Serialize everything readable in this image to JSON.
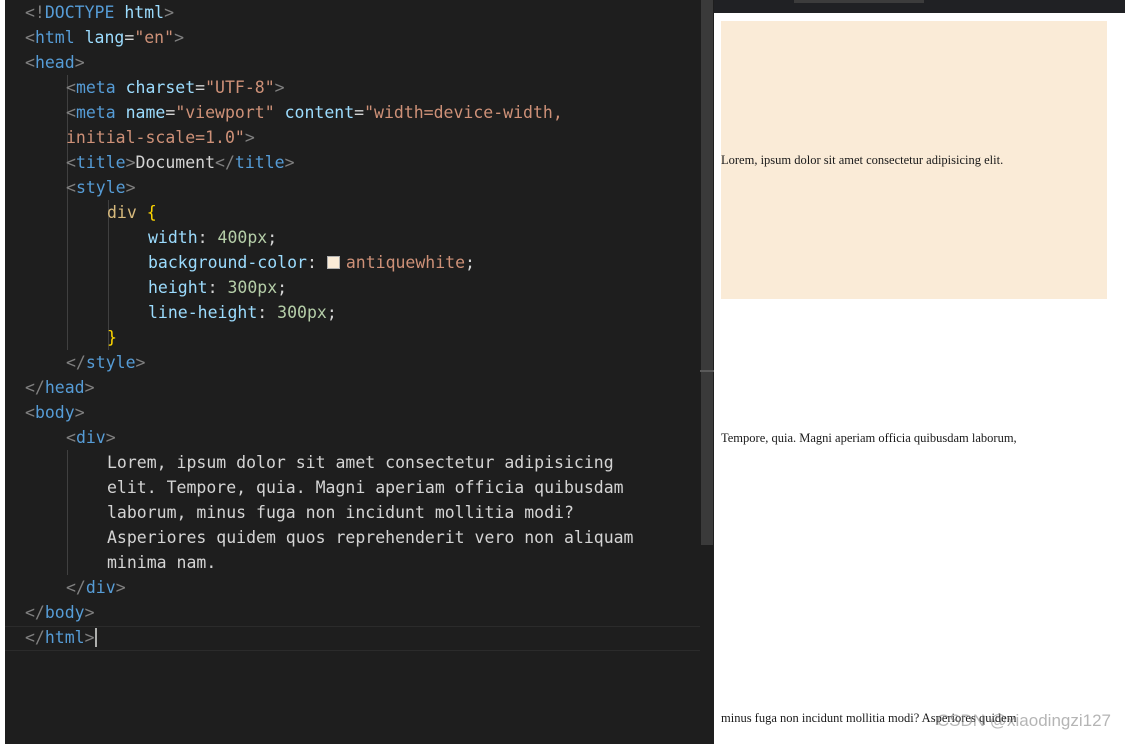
{
  "editor": {
    "lines": [
      [
        [
          "t-punc",
          "<!"
        ],
        [
          "t-kw",
          "DOCTYPE"
        ],
        [
          "t-text",
          " "
        ],
        [
          "t-attr",
          "html"
        ],
        [
          "t-punc",
          ">"
        ]
      ],
      [
        [
          "t-punc",
          "<"
        ],
        [
          "t-tag",
          "html"
        ],
        [
          "t-text",
          " "
        ],
        [
          "t-attr",
          "lang"
        ],
        [
          "t-text",
          "="
        ],
        [
          "t-str",
          "\"en\""
        ],
        [
          "t-punc",
          ">"
        ]
      ],
      [
        [
          "t-punc",
          "<"
        ],
        [
          "t-tag",
          "head"
        ],
        [
          "t-punc",
          ">"
        ]
      ],
      [
        [
          "t-punc",
          "<"
        ],
        [
          "t-tag",
          "meta"
        ],
        [
          "t-text",
          " "
        ],
        [
          "t-attr",
          "charset"
        ],
        [
          "t-text",
          "="
        ],
        [
          "t-str",
          "\"UTF-8\""
        ],
        [
          "t-punc",
          ">"
        ]
      ],
      [
        [
          "t-punc",
          "<"
        ],
        [
          "t-tag",
          "meta"
        ],
        [
          "t-text",
          " "
        ],
        [
          "t-attr",
          "name"
        ],
        [
          "t-text",
          "="
        ],
        [
          "t-str",
          "\"viewport\""
        ],
        [
          "t-text",
          " "
        ],
        [
          "t-attr",
          "content"
        ],
        [
          "t-text",
          "="
        ],
        [
          "t-str",
          "\"width=device-width,"
        ]
      ],
      [
        [
          "t-str",
          "initial-scale=1.0\""
        ],
        [
          "t-punc",
          ">"
        ]
      ],
      [
        [
          "t-punc",
          "<"
        ],
        [
          "t-tag",
          "title"
        ],
        [
          "t-punc",
          ">"
        ],
        [
          "t-text",
          "Document"
        ],
        [
          "t-punc",
          "</"
        ],
        [
          "t-tag",
          "title"
        ],
        [
          "t-punc",
          ">"
        ]
      ],
      [
        [
          "t-punc",
          "<"
        ],
        [
          "t-tag",
          "style"
        ],
        [
          "t-punc",
          ">"
        ]
      ],
      [
        [
          "t-sel",
          "div"
        ],
        [
          "t-text",
          " "
        ],
        [
          "t-brace",
          "{"
        ]
      ],
      [
        [
          "t-prop",
          "width"
        ],
        [
          "t-text",
          ": "
        ],
        [
          "t-num",
          "400px"
        ],
        [
          "t-text",
          ";"
        ]
      ],
      [
        [
          "t-prop",
          "background-color"
        ],
        [
          "t-text",
          ": "
        ],
        [
          "swatch",
          ""
        ],
        [
          "t-val",
          "antiquewhite"
        ],
        [
          "t-text",
          ";"
        ]
      ],
      [
        [
          "t-prop",
          "height"
        ],
        [
          "t-text",
          ": "
        ],
        [
          "t-num",
          "300px"
        ],
        [
          "t-text",
          ";"
        ]
      ],
      [
        [
          "t-prop",
          "line-height"
        ],
        [
          "t-text",
          ": "
        ],
        [
          "t-num",
          "300px"
        ],
        [
          "t-text",
          ";"
        ]
      ],
      [
        [
          "t-brace",
          "}"
        ]
      ],
      [
        [
          "t-punc",
          "</"
        ],
        [
          "t-tag",
          "style"
        ],
        [
          "t-punc",
          ">"
        ]
      ],
      [
        [
          "t-punc",
          "</"
        ],
        [
          "t-tag",
          "head"
        ],
        [
          "t-punc",
          ">"
        ]
      ],
      [
        [
          "t-punc",
          "<"
        ],
        [
          "t-tag",
          "body"
        ],
        [
          "t-punc",
          ">"
        ]
      ],
      [
        [
          "t-punc",
          "<"
        ],
        [
          "t-tag",
          "div"
        ],
        [
          "t-punc",
          ">"
        ]
      ],
      [
        [
          "t-text",
          "Lorem, ipsum dolor sit amet consectetur adipisicing"
        ]
      ],
      [
        [
          "t-text",
          "elit. Tempore, quia. Magni aperiam officia quibusdam"
        ]
      ],
      [
        [
          "t-text",
          "laborum, minus fuga non incidunt mollitia modi?"
        ]
      ],
      [
        [
          "t-text",
          "Asperiores quidem quos reprehenderit vero non aliquam"
        ]
      ],
      [
        [
          "t-text",
          "minima nam."
        ]
      ],
      [
        [
          "t-punc",
          "</"
        ],
        [
          "t-tag",
          "div"
        ],
        [
          "t-punc",
          ">"
        ]
      ],
      [
        [
          "t-punc",
          "</"
        ],
        [
          "t-tag",
          "body"
        ],
        [
          "t-punc",
          ">"
        ]
      ],
      [
        [
          "t-punc",
          "</"
        ],
        [
          "t-tag",
          "html"
        ],
        [
          "t-punc",
          ">"
        ]
      ]
    ]
  },
  "preview": {
    "box_color": "#faebd7",
    "lines": [
      "Lorem, ipsum dolor sit amet consectetur adipisicing elit.",
      "Tempore, quia. Magni aperiam officia quibusdam laborum,",
      "minus fuga non incidunt mollitia modi? Asperiores quidem"
    ]
  },
  "watermark": "CSDN @xiaodingzi127",
  "colors": {
    "editor_bg": "#1e1e1e",
    "tag": "#569cd6",
    "attribute": "#9cdcfe",
    "string": "#ce9178",
    "number": "#b5cea8",
    "selector": "#d7ba7d",
    "brace": "#ffd700"
  }
}
